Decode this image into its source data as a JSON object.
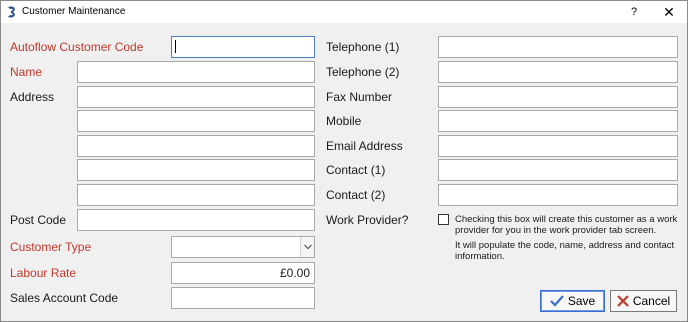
{
  "window": {
    "title": "Customer Maintenance",
    "help_label": "?",
    "close_label": "✕",
    "app_icon": "app-icon"
  },
  "left": {
    "autoflow_code": {
      "label": "Autoflow Customer Code",
      "value": ""
    },
    "name": {
      "label": "Name",
      "value": ""
    },
    "address": {
      "label": "Address",
      "lines": [
        "",
        "",
        "",
        "",
        ""
      ]
    },
    "post_code": {
      "label": "Post Code",
      "value": ""
    },
    "customer_type": {
      "label": "Customer Type",
      "value": ""
    },
    "labour_rate": {
      "label": "Labour Rate",
      "value": "£0.00"
    },
    "sales_account_code": {
      "label": "Sales Account Code",
      "value": ""
    }
  },
  "right": {
    "telephone1": {
      "label": "Telephone (1)",
      "value": ""
    },
    "telephone2": {
      "label": "Telephone (2)",
      "value": ""
    },
    "fax": {
      "label": "Fax Number",
      "value": ""
    },
    "mobile": {
      "label": "Mobile",
      "value": ""
    },
    "email": {
      "label": "Email Address",
      "value": ""
    },
    "contact1": {
      "label": "Contact (1)",
      "value": ""
    },
    "contact2": {
      "label": "Contact (2)",
      "value": ""
    },
    "work_provider": {
      "label": "Work Provider?",
      "checked": false,
      "note1": "Checking this box will create this customer as a work provider for you in the work provider tab screen.",
      "note2": "It will populate the code, name, address and contact information."
    }
  },
  "buttons": {
    "save": "Save",
    "cancel": "Cancel"
  },
  "colors": {
    "required_label": "#c0392b",
    "focus_border": "#4f7fc8",
    "save_check": "#3b6fd1",
    "cancel_x": "#c0392b"
  }
}
